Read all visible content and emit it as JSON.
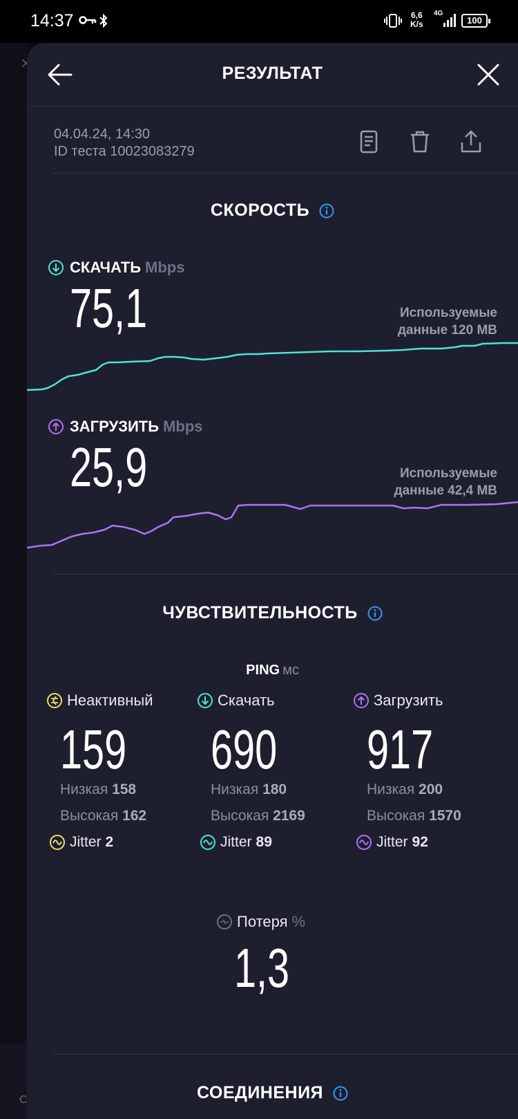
{
  "status_bar": {
    "time": "14:37",
    "net_speed_value": "6,6",
    "net_speed_unit": "K/s",
    "net_type": "4G",
    "battery": "100"
  },
  "header": {
    "title": "РЕЗУЛЬТАТ"
  },
  "test_info": {
    "datetime": "04.04.24, 14:30",
    "test_id": "ID теста 10023083279"
  },
  "speed": {
    "section_title": "СКОРОСТЬ",
    "download": {
      "label": "СКАЧАТЬ",
      "unit": "Mbps",
      "value": "75,1",
      "used_line1": "Используемые",
      "used_line2": "данные 120 MB",
      "color": "#4fe3d6"
    },
    "upload": {
      "label": "ЗАГРУЗИТЬ",
      "unit": "Mbps",
      "value": "25,9",
      "used_line1": "Используемые",
      "used_line2": "данные 42,4 MB",
      "color": "#b072f5"
    }
  },
  "responsiveness": {
    "section_title": "ЧУВСТВИТЕЛЬНОСТЬ",
    "ping_label": "PING",
    "ping_unit": "мс",
    "idle": {
      "label": "Неактивный",
      "value": "159",
      "low_label": "Низкая",
      "low": "158",
      "high_label": "Высокая",
      "high": "162",
      "jitter_label": "Jitter",
      "jitter": "2",
      "color": "#f0dc6e"
    },
    "download": {
      "label": "Скачать",
      "value": "690",
      "low_label": "Низкая",
      "low": "180",
      "high_label": "Высокая",
      "high": "2169",
      "jitter_label": "Jitter",
      "jitter": "89",
      "color": "#4fe3d6"
    },
    "upload": {
      "label": "Загрузить",
      "value": "917",
      "low_label": "Низкая",
      "low": "200",
      "high_label": "Высокая",
      "high": "1570",
      "jitter_label": "Jitter",
      "jitter": "92",
      "color": "#b072f5"
    },
    "loss": {
      "label": "Потеря",
      "unit": "%",
      "value": "1,3"
    }
  },
  "connections": {
    "section_title": "СОЕДИНЕНИЯ"
  },
  "background": {
    "partial_letter": "С"
  },
  "info_color": "#2f9bf0"
}
